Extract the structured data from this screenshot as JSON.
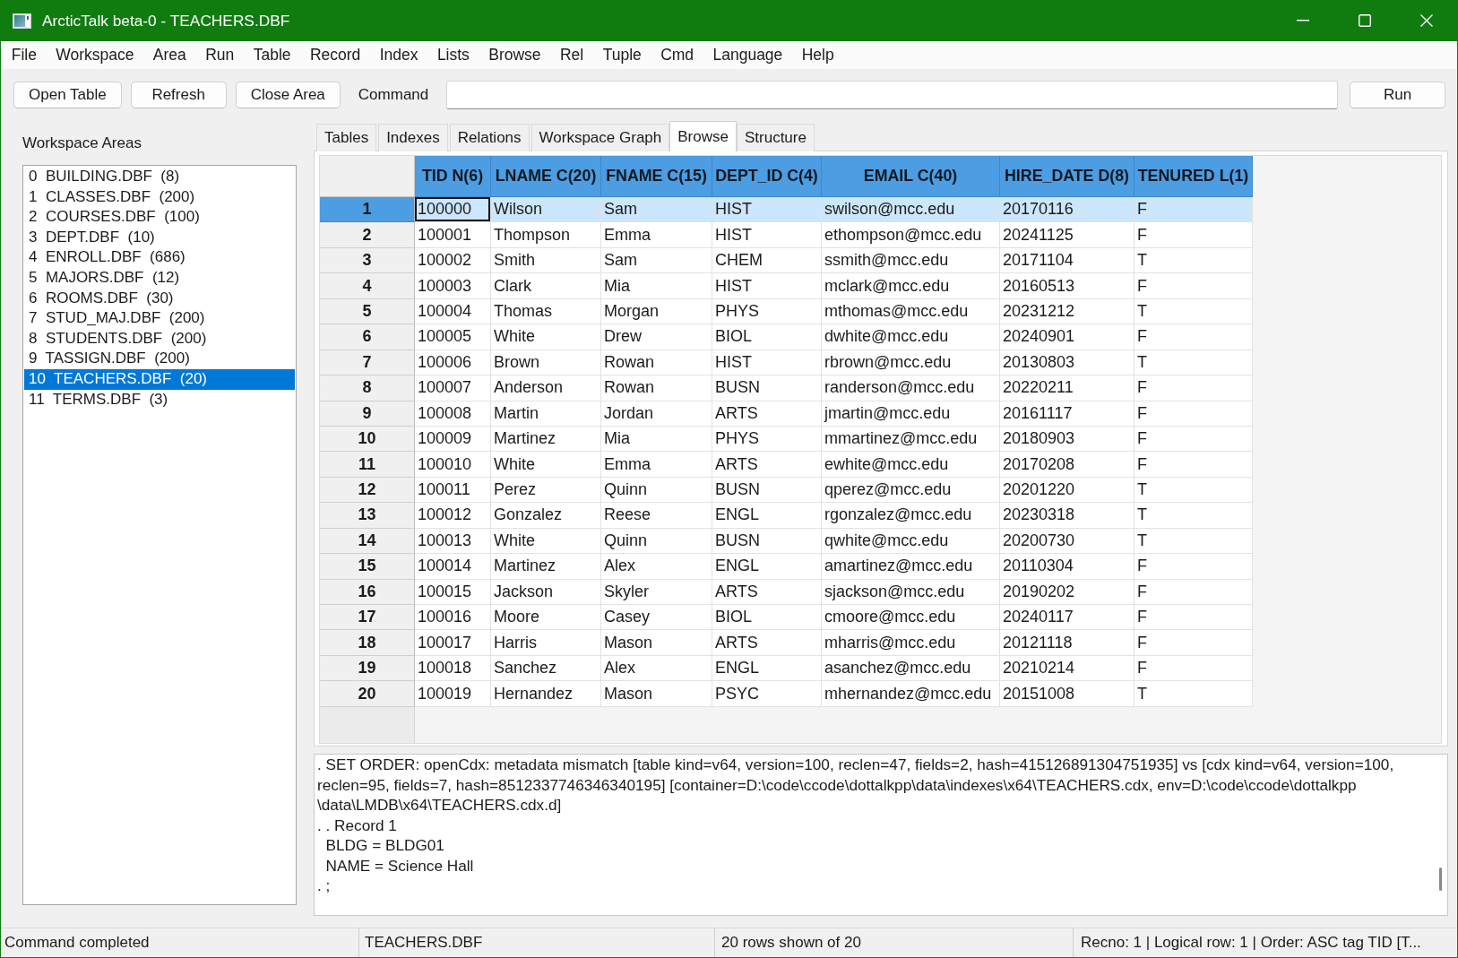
{
  "window": {
    "title": "ArcticTalk beta-0 - TEACHERS.DBF"
  },
  "menu": [
    "File",
    "Workspace",
    "Area",
    "Run",
    "Table",
    "Record",
    "Index",
    "Lists",
    "Browse",
    "Rel",
    "Tuple",
    "Cmd",
    "Language",
    "Help"
  ],
  "toolbar": {
    "buttons": [
      "Open Table",
      "Refresh",
      "Close Area"
    ],
    "command_label": "Command",
    "run_button": "Run"
  },
  "workspace_areas": {
    "title": "Workspace Areas",
    "items": [
      {
        "label": "0  BUILDING.DBF  (8)",
        "selected": false
      },
      {
        "label": "1  CLASSES.DBF  (200)",
        "selected": false
      },
      {
        "label": "2  COURSES.DBF  (100)",
        "selected": false
      },
      {
        "label": "3  DEPT.DBF  (10)",
        "selected": false
      },
      {
        "label": "4  ENROLL.DBF  (686)",
        "selected": false
      },
      {
        "label": "5  MAJORS.DBF  (12)",
        "selected": false
      },
      {
        "label": "6  ROOMS.DBF  (30)",
        "selected": false
      },
      {
        "label": "7  STUD_MAJ.DBF  (200)",
        "selected": false
      },
      {
        "label": "8  STUDENTS.DBF  (200)",
        "selected": false
      },
      {
        "label": "9  TASSIGN.DBF  (200)",
        "selected": false
      },
      {
        "label": "10  TEACHERS.DBF  (20)",
        "selected": true
      },
      {
        "label": "11  TERMS.DBF  (3)",
        "selected": false
      }
    ]
  },
  "tabs": [
    {
      "label": "Tables",
      "selected": false
    },
    {
      "label": "Indexes",
      "selected": false
    },
    {
      "label": "Relations",
      "selected": false
    },
    {
      "label": "Workspace Graph",
      "selected": false
    },
    {
      "label": "Browse",
      "selected": true
    },
    {
      "label": "Structure",
      "selected": false
    }
  ],
  "browse": {
    "columns": [
      "TID N(6)",
      "LNAME C(20)",
      "FNAME C(15)",
      "DEPT_ID C(4)",
      "EMAIL C(40)",
      "HIRE_DATE D(8)",
      "TENURED L(1)"
    ],
    "rows": [
      {
        "number": "1",
        "selected": true,
        "cells": [
          {
            "text": "100000",
            "focused": true
          },
          {
            "text": "Wilson",
            "focused": false
          },
          {
            "text": "Sam",
            "focused": false
          },
          {
            "text": "HIST",
            "focused": false
          },
          {
            "text": "swilson@mcc.edu",
            "focused": false
          },
          {
            "text": "20170116",
            "focused": false
          },
          {
            "text": "F",
            "focused": false
          }
        ]
      },
      {
        "number": "2",
        "selected": false,
        "cells": [
          {
            "text": "100001",
            "focused": false
          },
          {
            "text": "Thompson",
            "focused": false
          },
          {
            "text": "Emma",
            "focused": false
          },
          {
            "text": "HIST",
            "focused": false
          },
          {
            "text": "ethompson@mcc.edu",
            "focused": false
          },
          {
            "text": "20241125",
            "focused": false
          },
          {
            "text": "F",
            "focused": false
          }
        ]
      },
      {
        "number": "3",
        "selected": false,
        "cells": [
          {
            "text": "100002",
            "focused": false
          },
          {
            "text": "Smith",
            "focused": false
          },
          {
            "text": "Sam",
            "focused": false
          },
          {
            "text": "CHEM",
            "focused": false
          },
          {
            "text": "ssmith@mcc.edu",
            "focused": false
          },
          {
            "text": "20171104",
            "focused": false
          },
          {
            "text": "T",
            "focused": false
          }
        ]
      },
      {
        "number": "4",
        "selected": false,
        "cells": [
          {
            "text": "100003",
            "focused": false
          },
          {
            "text": "Clark",
            "focused": false
          },
          {
            "text": "Mia",
            "focused": false
          },
          {
            "text": "HIST",
            "focused": false
          },
          {
            "text": "mclark@mcc.edu",
            "focused": false
          },
          {
            "text": "20160513",
            "focused": false
          },
          {
            "text": "F",
            "focused": false
          }
        ]
      },
      {
        "number": "5",
        "selected": false,
        "cells": [
          {
            "text": "100004",
            "focused": false
          },
          {
            "text": "Thomas",
            "focused": false
          },
          {
            "text": "Morgan",
            "focused": false
          },
          {
            "text": "PHYS",
            "focused": false
          },
          {
            "text": "mthomas@mcc.edu",
            "focused": false
          },
          {
            "text": "20231212",
            "focused": false
          },
          {
            "text": "T",
            "focused": false
          }
        ]
      },
      {
        "number": "6",
        "selected": false,
        "cells": [
          {
            "text": "100005",
            "focused": false
          },
          {
            "text": "White",
            "focused": false
          },
          {
            "text": "Drew",
            "focused": false
          },
          {
            "text": "BIOL",
            "focused": false
          },
          {
            "text": "dwhite@mcc.edu",
            "focused": false
          },
          {
            "text": "20240901",
            "focused": false
          },
          {
            "text": "F",
            "focused": false
          }
        ]
      },
      {
        "number": "7",
        "selected": false,
        "cells": [
          {
            "text": "100006",
            "focused": false
          },
          {
            "text": "Brown",
            "focused": false
          },
          {
            "text": "Rowan",
            "focused": false
          },
          {
            "text": "HIST",
            "focused": false
          },
          {
            "text": "rbrown@mcc.edu",
            "focused": false
          },
          {
            "text": "20130803",
            "focused": false
          },
          {
            "text": "T",
            "focused": false
          }
        ]
      },
      {
        "number": "8",
        "selected": false,
        "cells": [
          {
            "text": "100007",
            "focused": false
          },
          {
            "text": "Anderson",
            "focused": false
          },
          {
            "text": "Rowan",
            "focused": false
          },
          {
            "text": "BUSN",
            "focused": false
          },
          {
            "text": "randerson@mcc.edu",
            "focused": false
          },
          {
            "text": "20220211",
            "focused": false
          },
          {
            "text": "F",
            "focused": false
          }
        ]
      },
      {
        "number": "9",
        "selected": false,
        "cells": [
          {
            "text": "100008",
            "focused": false
          },
          {
            "text": "Martin",
            "focused": false
          },
          {
            "text": "Jordan",
            "focused": false
          },
          {
            "text": "ARTS",
            "focused": false
          },
          {
            "text": "jmartin@mcc.edu",
            "focused": false
          },
          {
            "text": "20161117",
            "focused": false
          },
          {
            "text": "F",
            "focused": false
          }
        ]
      },
      {
        "number": "10",
        "selected": false,
        "cells": [
          {
            "text": "100009",
            "focused": false
          },
          {
            "text": "Martinez",
            "focused": false
          },
          {
            "text": "Mia",
            "focused": false
          },
          {
            "text": "PHYS",
            "focused": false
          },
          {
            "text": "mmartinez@mcc.edu",
            "focused": false
          },
          {
            "text": "20180903",
            "focused": false
          },
          {
            "text": "F",
            "focused": false
          }
        ]
      },
      {
        "number": "11",
        "selected": false,
        "cells": [
          {
            "text": "100010",
            "focused": false
          },
          {
            "text": "White",
            "focused": false
          },
          {
            "text": "Emma",
            "focused": false
          },
          {
            "text": "ARTS",
            "focused": false
          },
          {
            "text": "ewhite@mcc.edu",
            "focused": false
          },
          {
            "text": "20170208",
            "focused": false
          },
          {
            "text": "F",
            "focused": false
          }
        ]
      },
      {
        "number": "12",
        "selected": false,
        "cells": [
          {
            "text": "100011",
            "focused": false
          },
          {
            "text": "Perez",
            "focused": false
          },
          {
            "text": "Quinn",
            "focused": false
          },
          {
            "text": "BUSN",
            "focused": false
          },
          {
            "text": "qperez@mcc.edu",
            "focused": false
          },
          {
            "text": "20201220",
            "focused": false
          },
          {
            "text": "T",
            "focused": false
          }
        ]
      },
      {
        "number": "13",
        "selected": false,
        "cells": [
          {
            "text": "100012",
            "focused": false
          },
          {
            "text": "Gonzalez",
            "focused": false
          },
          {
            "text": "Reese",
            "focused": false
          },
          {
            "text": "ENGL",
            "focused": false
          },
          {
            "text": "rgonzalez@mcc.edu",
            "focused": false
          },
          {
            "text": "20230318",
            "focused": false
          },
          {
            "text": "T",
            "focused": false
          }
        ]
      },
      {
        "number": "14",
        "selected": false,
        "cells": [
          {
            "text": "100013",
            "focused": false
          },
          {
            "text": "White",
            "focused": false
          },
          {
            "text": "Quinn",
            "focused": false
          },
          {
            "text": "BUSN",
            "focused": false
          },
          {
            "text": "qwhite@mcc.edu",
            "focused": false
          },
          {
            "text": "20200730",
            "focused": false
          },
          {
            "text": "T",
            "focused": false
          }
        ]
      },
      {
        "number": "15",
        "selected": false,
        "cells": [
          {
            "text": "100014",
            "focused": false
          },
          {
            "text": "Martinez",
            "focused": false
          },
          {
            "text": "Alex",
            "focused": false
          },
          {
            "text": "ENGL",
            "focused": false
          },
          {
            "text": "amartinez@mcc.edu",
            "focused": false
          },
          {
            "text": "20110304",
            "focused": false
          },
          {
            "text": "F",
            "focused": false
          }
        ]
      },
      {
        "number": "16",
        "selected": false,
        "cells": [
          {
            "text": "100015",
            "focused": false
          },
          {
            "text": "Jackson",
            "focused": false
          },
          {
            "text": "Skyler",
            "focused": false
          },
          {
            "text": "ARTS",
            "focused": false
          },
          {
            "text": "sjackson@mcc.edu",
            "focused": false
          },
          {
            "text": "20190202",
            "focused": false
          },
          {
            "text": "F",
            "focused": false
          }
        ]
      },
      {
        "number": "17",
        "selected": false,
        "cells": [
          {
            "text": "100016",
            "focused": false
          },
          {
            "text": "Moore",
            "focused": false
          },
          {
            "text": "Casey",
            "focused": false
          },
          {
            "text": "BIOL",
            "focused": false
          },
          {
            "text": "cmoore@mcc.edu",
            "focused": false
          },
          {
            "text": "20240117",
            "focused": false
          },
          {
            "text": "F",
            "focused": false
          }
        ]
      },
      {
        "number": "18",
        "selected": false,
        "cells": [
          {
            "text": "100017",
            "focused": false
          },
          {
            "text": "Harris",
            "focused": false
          },
          {
            "text": "Mason",
            "focused": false
          },
          {
            "text": "ARTS",
            "focused": false
          },
          {
            "text": "mharris@mcc.edu",
            "focused": false
          },
          {
            "text": "20121118",
            "focused": false
          },
          {
            "text": "F",
            "focused": false
          }
        ]
      },
      {
        "number": "19",
        "selected": false,
        "cells": [
          {
            "text": "100018",
            "focused": false
          },
          {
            "text": "Sanchez",
            "focused": false
          },
          {
            "text": "Alex",
            "focused": false
          },
          {
            "text": "ENGL",
            "focused": false
          },
          {
            "text": "asanchez@mcc.edu",
            "focused": false
          },
          {
            "text": "20210214",
            "focused": false
          },
          {
            "text": "F",
            "focused": false
          }
        ]
      },
      {
        "number": "20",
        "selected": false,
        "cells": [
          {
            "text": "100019",
            "focused": false
          },
          {
            "text": "Hernandez",
            "focused": false
          },
          {
            "text": "Mason",
            "focused": false
          },
          {
            "text": "PSYC",
            "focused": false
          },
          {
            "text": "mhernandez@mcc.edu",
            "focused": false
          },
          {
            "text": "20151008",
            "focused": false
          },
          {
            "text": "T",
            "focused": false
          }
        ]
      }
    ]
  },
  "output_log": {
    "lines": [
      ". SET ORDER: openCdx: metadata mismatch [table kind=v64, version=100, reclen=47, fields=2, hash=415126891304751935] vs [cdx kind=v64, version=100,",
      "reclen=95, fields=7, hash=8512337746346340195] [container=D:\\code\\ccode\\dottalkpp\\data\\indexes\\x64\\TEACHERS.cdx, env=D:\\code\\ccode\\dottalkpp",
      "\\data\\LMDB\\x64\\TEACHERS.cdx.d]",
      ". . Record 1",
      "  BLDG = BLDG01",
      "  NAME = Science Hall",
      ". ;"
    ]
  },
  "status_bar": [
    "Command completed",
    "TEACHERS.DBF",
    "20 rows shown of 20",
    "Recno: 1 | Logical row: 1 | Order: ASC tag TID [T..."
  ]
}
